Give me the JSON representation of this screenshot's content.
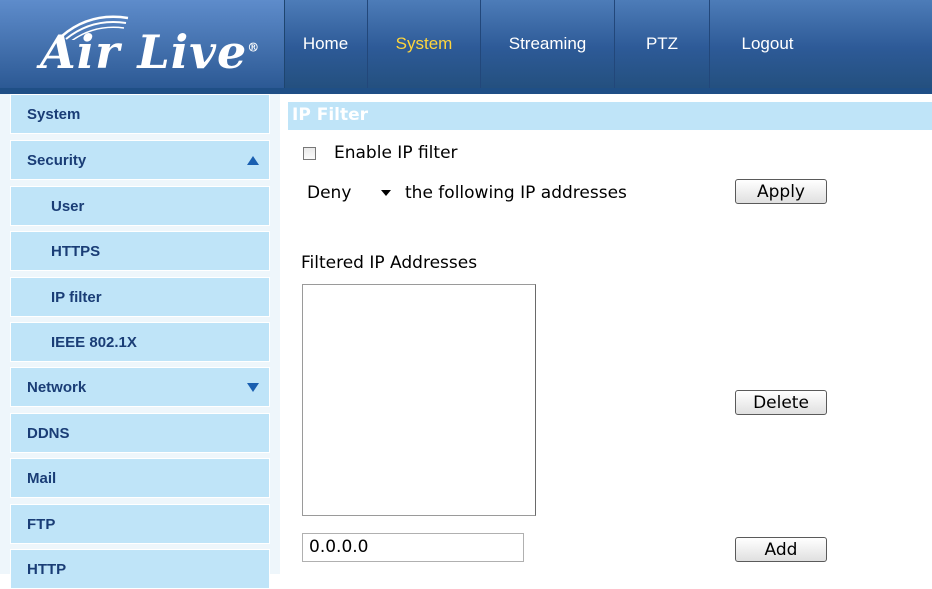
{
  "brand": {
    "logo_text": "Air Live",
    "logo_mark": "®"
  },
  "nav": {
    "tabs": [
      {
        "label": "Home",
        "active": false
      },
      {
        "label": "System",
        "active": true
      },
      {
        "label": "Streaming",
        "active": false
      },
      {
        "label": "PTZ",
        "active": false
      },
      {
        "label": "Logout",
        "active": false
      }
    ]
  },
  "sidebar": {
    "items": [
      {
        "label": "System"
      },
      {
        "label": "Security",
        "expanded": true
      },
      {
        "label": "User"
      },
      {
        "label": "HTTPS"
      },
      {
        "label": "IP filter"
      },
      {
        "label": "IEEE 802.1X"
      },
      {
        "label": "Network",
        "expanded": false
      },
      {
        "label": "DDNS"
      },
      {
        "label": "Mail"
      },
      {
        "label": "FTP"
      },
      {
        "label": "HTTP"
      }
    ]
  },
  "main": {
    "section_title": "IP Filter",
    "enable_label": "Enable IP filter",
    "enable_checked": false,
    "policy_value": "Deny",
    "policy_suffix": "the following IP addresses",
    "apply_label": "Apply",
    "list_title": "Filtered IP Addresses",
    "delete_label": "Delete",
    "ip_input_value": "0.0.0.0",
    "add_label": "Add"
  },
  "colors": {
    "header_blue": "#2d5a97",
    "active_tab": "#ffd53c",
    "sidebar_item": "#bfe4f8",
    "sidebar_text": "#1a3d76"
  }
}
